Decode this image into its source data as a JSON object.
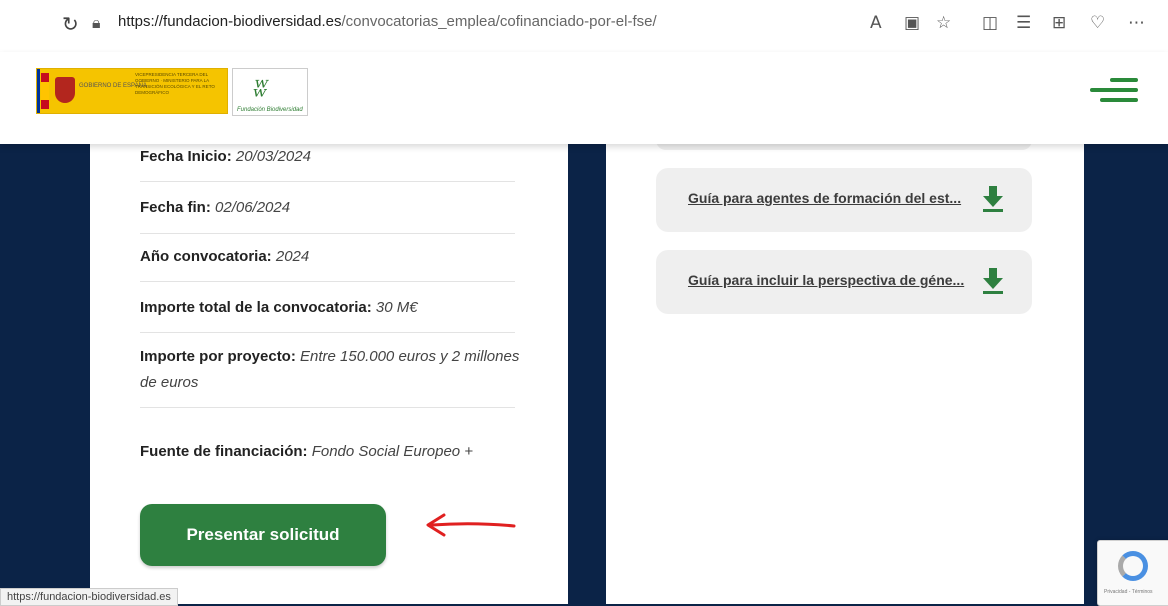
{
  "browser": {
    "url_host": "https://fundacion-biodiversidad.es",
    "url_path": "/convocatorias_emplea/cofinanciado-por-el-fse/",
    "icons": [
      "refresh-icon",
      "lock-icon",
      "read-aloud-icon",
      "immersive-reader-icon",
      "favorite-star-icon",
      "split-screen-icon",
      "favorites-icon",
      "collections-icon",
      "browser-essentials-icon",
      "more-icon"
    ]
  },
  "header": {
    "gov_logo_text": "GOBIERNO DE ESPAÑA",
    "gov_ministry": "VICEPRESIDENCIA TERCERA DEL GOBIERNO · MINISTERIO PARA LA TRANSICIÓN ECOLÓGICA Y EL RETO DEMOGRÁFICO",
    "foundation_logo_text": "Fundación Biodiversidad"
  },
  "details": [
    {
      "label": "Fecha Inicio:",
      "value": "20/03/2024"
    },
    {
      "label": "Fecha fin:",
      "value": "02/06/2024"
    },
    {
      "label": "Año convocatoria:",
      "value": "2024"
    },
    {
      "label": "Importe total de la convocatoria:",
      "value": "30 M€"
    },
    {
      "label": "Importe por proyecto:",
      "value": "Entre 150.000 euros y 2 millones de euros"
    },
    {
      "label": "Fuente de financiación:",
      "value": "Fondo Social Europeo +"
    }
  ],
  "apply_button": "Presentar solicitud",
  "downloads": [
    {
      "label": "Guía para agentes de formación del est..."
    },
    {
      "label": "Guía para incluir la perspectiva de géne..."
    }
  ],
  "status_bar_url": "https://fundacion-biodiversidad.es",
  "recaptcha_text": "Privacidad - Términos",
  "colors": {
    "accent_green": "#2e8040",
    "background_navy": "#0b2347",
    "annotation_red": "#e02020"
  }
}
